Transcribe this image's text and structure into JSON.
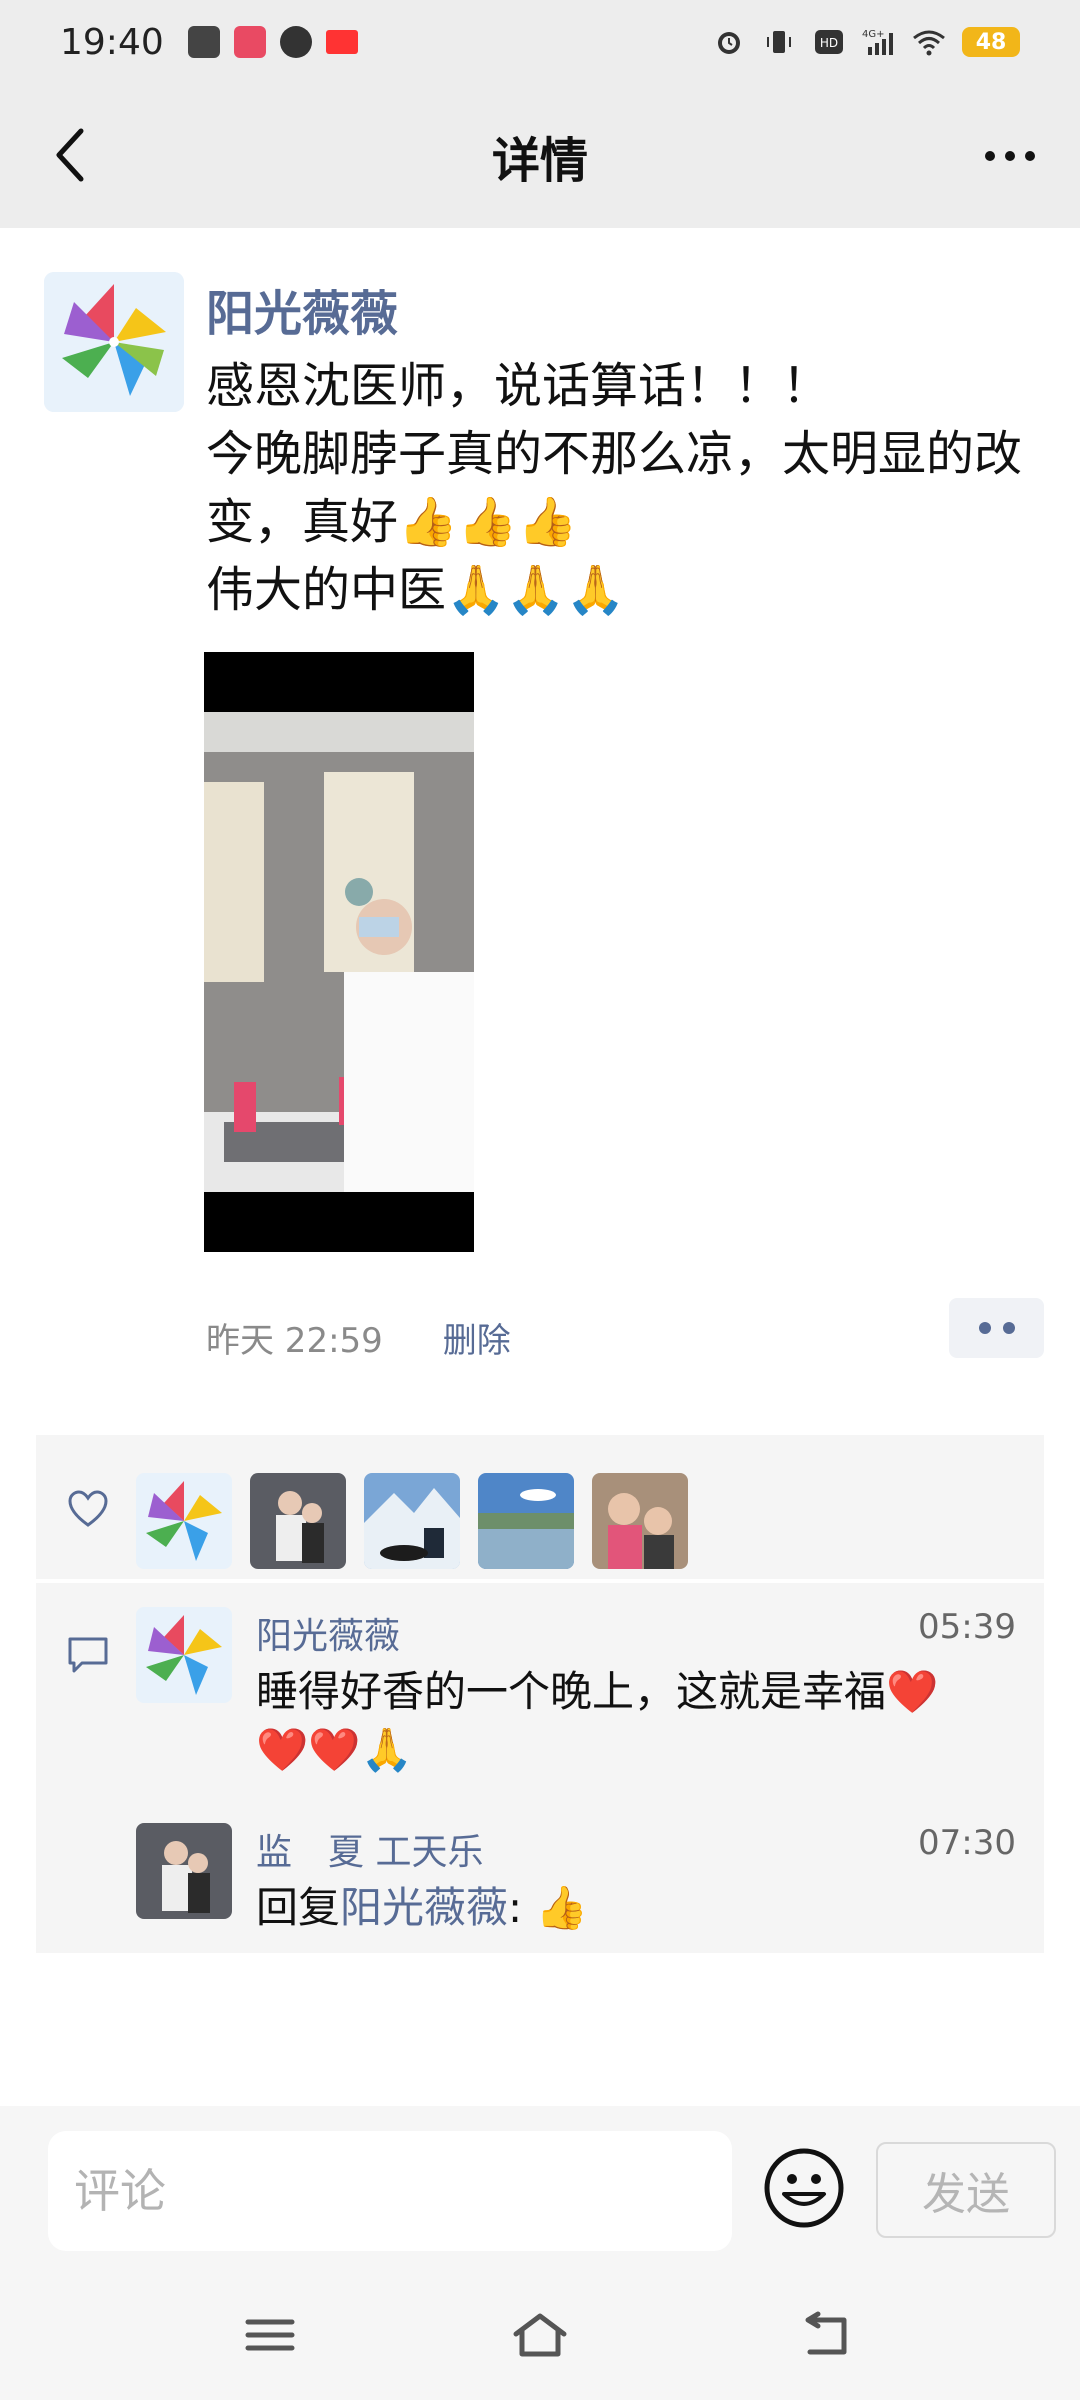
{
  "status_bar": {
    "time": "19:40",
    "battery": "48",
    "network": "4G+",
    "hd": "HD"
  },
  "nav": {
    "title": "详情"
  },
  "post": {
    "author": "阳光薇薇",
    "text": "感恩沈医师，说话算话！！！\n今晚脚脖子真的不那么凉，太明显的改变，真好👍👍👍\n伟大的中医🙏🙏🙏",
    "time": "昨天  22:59",
    "delete_label": "删除"
  },
  "comments": [
    {
      "name": "阳光薇薇",
      "time": "05:39",
      "text": "睡得好香的一个晚上，这就是幸福❤️❤️❤️🙏"
    },
    {
      "name": "监　夏  工天乐",
      "time": "07:30",
      "reply_prefix": "回复",
      "reply_to": "阳光薇薇",
      "reply_text": ": 👍"
    }
  ],
  "input": {
    "placeholder": "评论",
    "send_label": "发送"
  },
  "colors": {
    "link": "#576b95",
    "battery": "#f2b619",
    "panel": "#f5f5f5"
  }
}
